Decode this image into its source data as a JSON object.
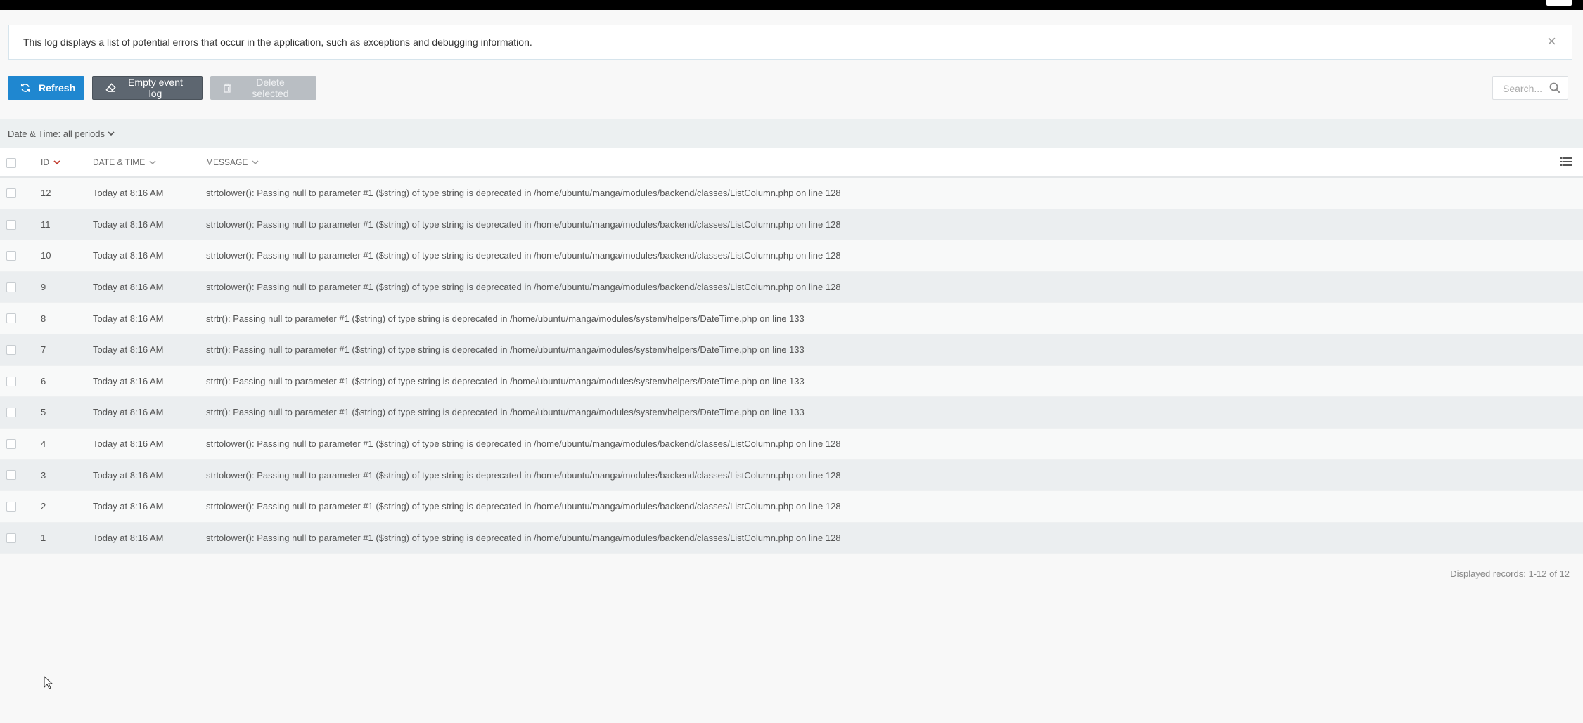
{
  "info": {
    "text": "This log displays a list of potential errors that occur in the application, such as exceptions and debugging information.",
    "close_label": "×"
  },
  "toolbar": {
    "refresh_label": "Refresh",
    "empty_label": "Empty event log",
    "delete_label": "Delete selected"
  },
  "search": {
    "placeholder": "Search..."
  },
  "filter": {
    "date_scope": "Date & Time: all periods"
  },
  "table": {
    "columns": {
      "id": "ID",
      "datetime": "DATE & TIME",
      "message": "MESSAGE"
    },
    "rows": [
      {
        "id": "12",
        "datetime": "Today at 8:16 AM",
        "message": "strtolower(): Passing null to parameter #1 ($string) of type string is deprecated in /home/ubuntu/manga/modules/backend/classes/ListColumn.php on line 128"
      },
      {
        "id": "11",
        "datetime": "Today at 8:16 AM",
        "message": "strtolower(): Passing null to parameter #1 ($string) of type string is deprecated in /home/ubuntu/manga/modules/backend/classes/ListColumn.php on line 128"
      },
      {
        "id": "10",
        "datetime": "Today at 8:16 AM",
        "message": "strtolower(): Passing null to parameter #1 ($string) of type string is deprecated in /home/ubuntu/manga/modules/backend/classes/ListColumn.php on line 128"
      },
      {
        "id": "9",
        "datetime": "Today at 8:16 AM",
        "message": "strtolower(): Passing null to parameter #1 ($string) of type string is deprecated in /home/ubuntu/manga/modules/backend/classes/ListColumn.php on line 128"
      },
      {
        "id": "8",
        "datetime": "Today at 8:16 AM",
        "message": "strtr(): Passing null to parameter #1 ($string) of type string is deprecated in /home/ubuntu/manga/modules/system/helpers/DateTime.php on line 133"
      },
      {
        "id": "7",
        "datetime": "Today at 8:16 AM",
        "message": "strtr(): Passing null to parameter #1 ($string) of type string is deprecated in /home/ubuntu/manga/modules/system/helpers/DateTime.php on line 133"
      },
      {
        "id": "6",
        "datetime": "Today at 8:16 AM",
        "message": "strtr(): Passing null to parameter #1 ($string) of type string is deprecated in /home/ubuntu/manga/modules/system/helpers/DateTime.php on line 133"
      },
      {
        "id": "5",
        "datetime": "Today at 8:16 AM",
        "message": "strtr(): Passing null to parameter #1 ($string) of type string is deprecated in /home/ubuntu/manga/modules/system/helpers/DateTime.php on line 133"
      },
      {
        "id": "4",
        "datetime": "Today at 8:16 AM",
        "message": "strtolower(): Passing null to parameter #1 ($string) of type string is deprecated in /home/ubuntu/manga/modules/backend/classes/ListColumn.php on line 128"
      },
      {
        "id": "3",
        "datetime": "Today at 8:16 AM",
        "message": "strtolower(): Passing null to parameter #1 ($string) of type string is deprecated in /home/ubuntu/manga/modules/backend/classes/ListColumn.php on line 128"
      },
      {
        "id": "2",
        "datetime": "Today at 8:16 AM",
        "message": "strtolower(): Passing null to parameter #1 ($string) of type string is deprecated in /home/ubuntu/manga/modules/backend/classes/ListColumn.php on line 128"
      },
      {
        "id": "1",
        "datetime": "Today at 8:16 AM",
        "message": "strtolower(): Passing null to parameter #1 ($string) of type string is deprecated in /home/ubuntu/manga/modules/backend/classes/ListColumn.php on line 128"
      }
    ]
  },
  "footer": {
    "records": "Displayed records: 1-12 of 12"
  },
  "icons": {
    "refresh": "refresh-icon",
    "empty": "eraser-icon",
    "delete": "trash-icon",
    "search": "search-icon",
    "sort_active": "chevron-down-icon",
    "list_setup": "list-settings-icon"
  },
  "colors": {
    "primary": "#1f87d0",
    "dark_button": "#5d6670",
    "sort_active": "#c0392b"
  }
}
